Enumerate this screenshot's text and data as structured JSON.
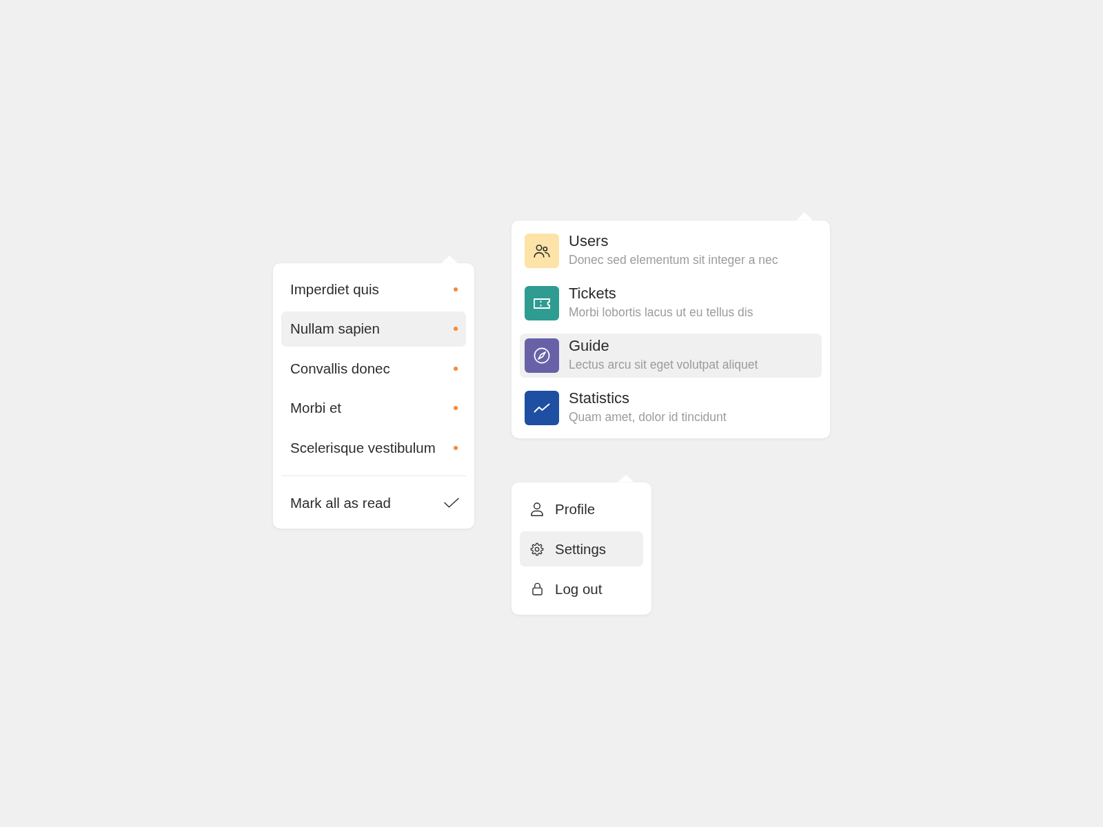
{
  "notifications": {
    "items": [
      {
        "label": "Imperdiet quis",
        "unread": true,
        "selected": false
      },
      {
        "label": "Nullam sapien",
        "unread": true,
        "selected": true
      },
      {
        "label": "Convallis donec",
        "unread": true,
        "selected": false
      },
      {
        "label": "Morbi et",
        "unread": true,
        "selected": false
      },
      {
        "label": "Scelerisque vestibulum",
        "unread": true,
        "selected": false
      }
    ],
    "action": {
      "label": "Mark all as read"
    }
  },
  "apps": {
    "items": [
      {
        "title": "Users",
        "description": "Donec sed elementum sit integer a nec",
        "color": "#fde3a8",
        "selected": false
      },
      {
        "title": "Tickets",
        "description": "Morbi lobortis lacus ut eu tellus dis",
        "color": "#2f9c91",
        "selected": false
      },
      {
        "title": "Guide",
        "description": "Lectus arcu sit eget volutpat aliquet",
        "color": "#6961a8",
        "selected": true
      },
      {
        "title": "Statistics",
        "description": "Quam amet, dolor id tincidunt",
        "color": "#1e4fa2",
        "selected": false
      }
    ]
  },
  "account": {
    "items": [
      {
        "label": "Profile",
        "selected": false
      },
      {
        "label": "Settings",
        "selected": true
      },
      {
        "label": "Log out",
        "selected": false
      }
    ]
  }
}
